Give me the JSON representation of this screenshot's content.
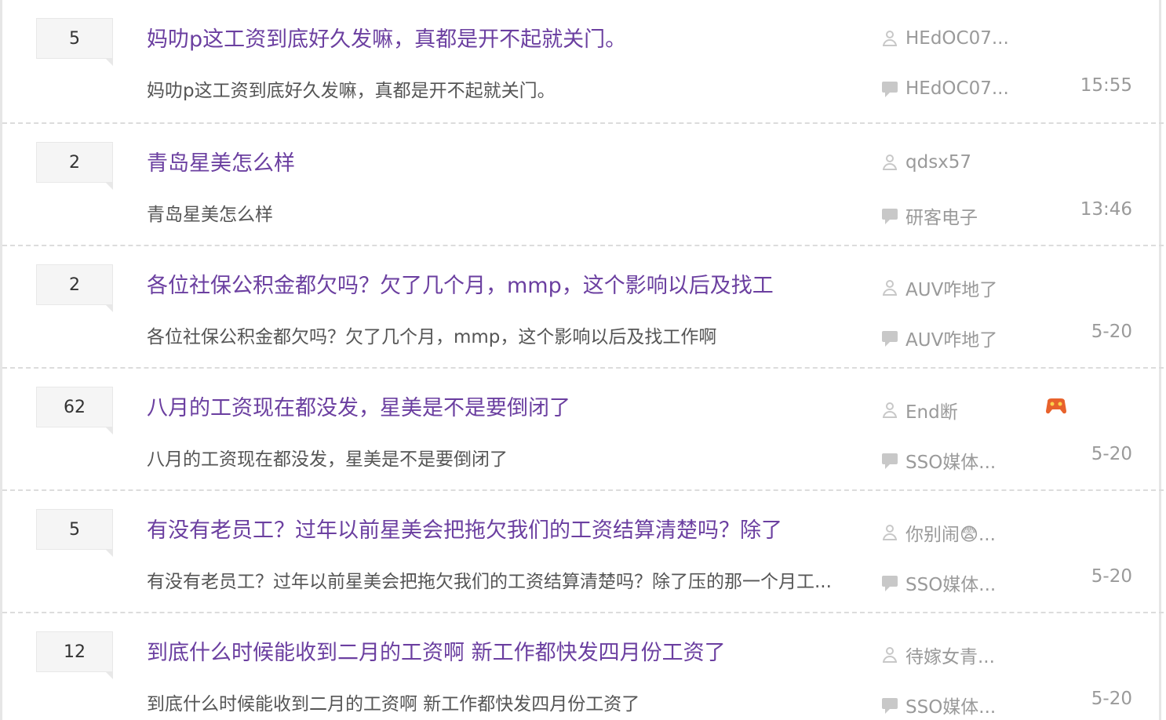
{
  "threads": [
    {
      "count": "5",
      "title": "妈叻p这工资到底好久发嘛，真都是开不起就关门。",
      "excerpt": "妈叻p这工资到底好久发嘛，真都是开不起就关门。",
      "author": "HEdOC07...",
      "last_replier": "HEdOC07...",
      "time": "15:55"
    },
    {
      "count": "2",
      "title": "青岛星美怎么样",
      "excerpt": "青岛星美怎么样",
      "author": "qdsx57",
      "last_replier": "研客电子",
      "time": "13:46"
    },
    {
      "count": "2",
      "title": "各位社保公积金都欠吗？欠了几个月，mmp，这个影响以后及找工",
      "excerpt": "各位社保公积金都欠吗？欠了几个月，mmp，这个影响以后及找工作啊",
      "author": "AUV咋地了",
      "last_replier": "AUV咋地了",
      "time": "5-20"
    },
    {
      "count": "62",
      "title": "八月的工资现在都没发，星美是不是要倒闭了",
      "excerpt": "八月的工资现在都没发，星美是不是要倒闭了",
      "author": "End断",
      "last_replier": "SSO媒体...",
      "time": "5-20",
      "badge": "game-badge-icon"
    },
    {
      "count": "5",
      "title": "有没有老员工？过年以前星美会把拖欠我们的工资结算清楚吗？除了",
      "excerpt": "有没有老员工？过年以前星美会把拖欠我们的工资结算清楚吗？除了压的那一个月工...",
      "author": "你别闹😨...",
      "last_replier": "SSO媒体...",
      "time": "5-20"
    },
    {
      "count": "12",
      "title": "到底什么时候能收到二月的工资啊 新工作都快发四月份工资了",
      "excerpt": "到底什么时候能收到二月的工资啊 新工作都快发四月份工资了",
      "author": "待嫁女青...",
      "last_replier": "SSO媒体...",
      "time": "5-20"
    }
  ],
  "colors": {
    "title": "#6b3fa0",
    "meta": "#9a9a9a",
    "excerpt": "#555555",
    "badge": "#e8622c"
  }
}
